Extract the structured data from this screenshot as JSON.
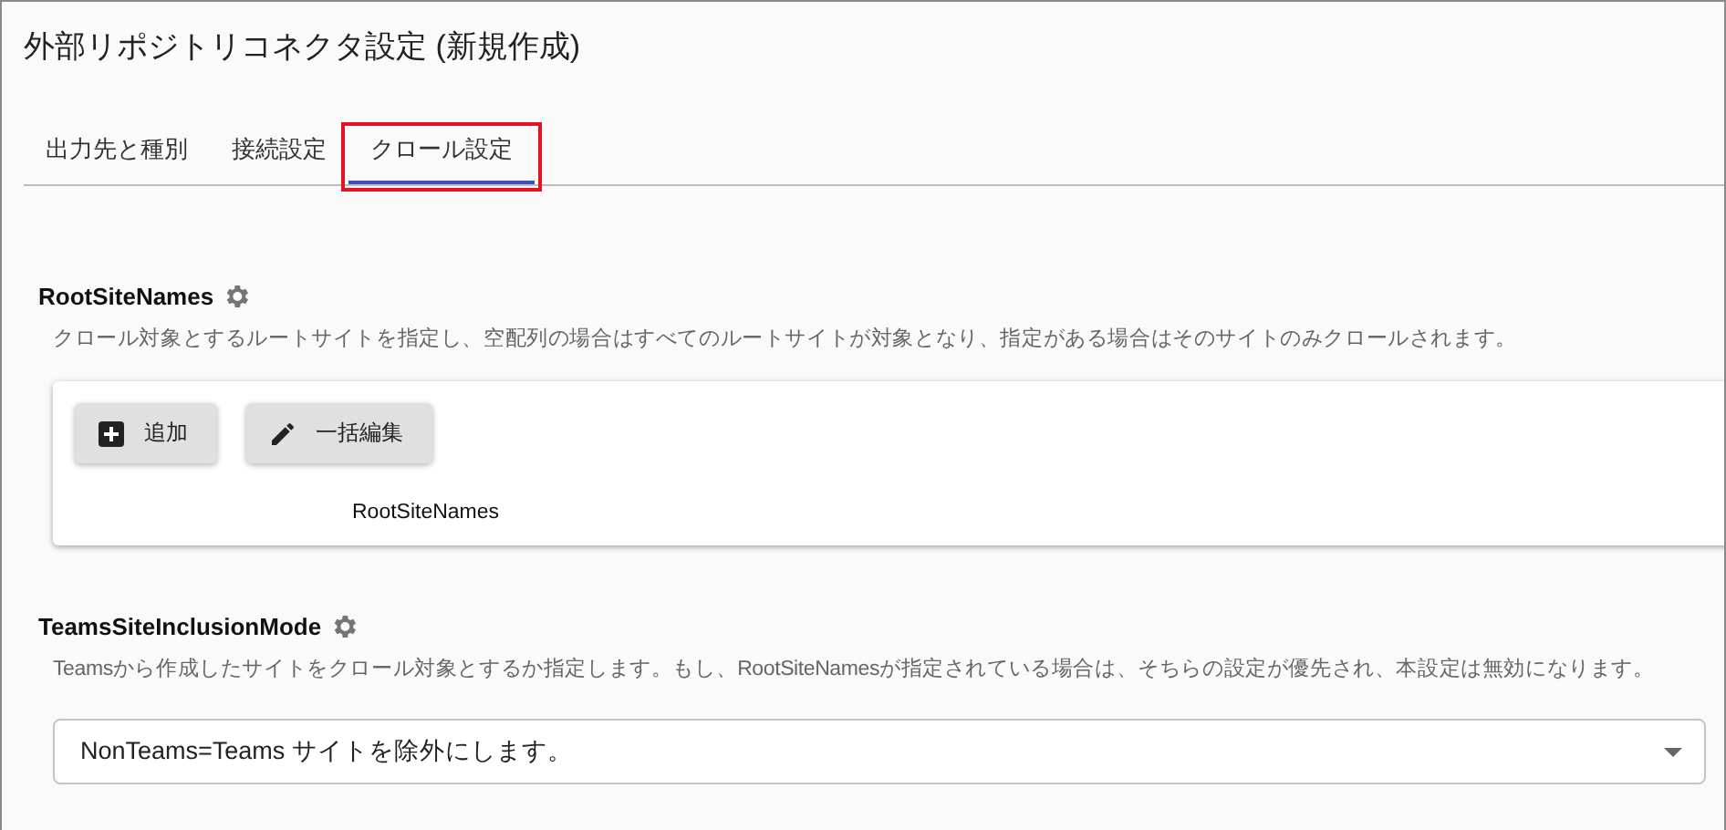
{
  "title": "外部リポジトリコネクタ設定 (新規作成)",
  "tabs": [
    {
      "label": "出力先と種別",
      "selected": false,
      "highlighted": false
    },
    {
      "label": "接続設定",
      "selected": false,
      "highlighted": false
    },
    {
      "label": "クロール設定",
      "selected": true,
      "highlighted": true
    }
  ],
  "sections": [
    {
      "kind": "list",
      "heading": "RootSiteNames",
      "description": "クロール対象とするルートサイトを指定し、空配列の場合はすべてのルートサイトが対象となり、指定がある場合はそのサイトのみクロールされます。",
      "buttons": [
        {
          "kind": "add",
          "label": "追加"
        },
        {
          "kind": "edit",
          "label": "一括編集"
        }
      ],
      "column": "RootSiteNames"
    },
    {
      "kind": "select",
      "heading": "TeamsSiteInclusionMode",
      "description": "Teamsから作成したサイトをクロール対象とするか指定します。もし、RootSiteNamesが指定されている場合は、そちらの設定が優先され、本設定は無効になります。",
      "value": "NonTeams=Teams サイトを除外にします。"
    }
  ]
}
